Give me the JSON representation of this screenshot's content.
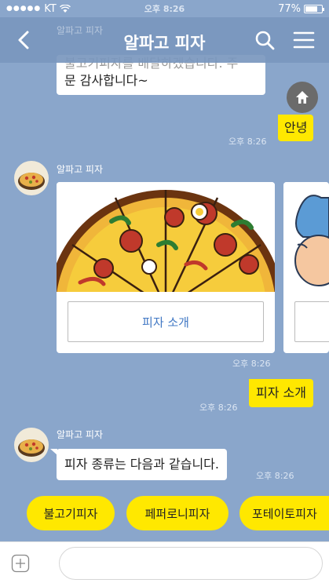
{
  "status": {
    "carrier": "KT",
    "time": "오후 8:26",
    "battery": "77%",
    "battery_level": 0.77
  },
  "header": {
    "title": "알파고 피자",
    "ghost_name": "알파고 피자"
  },
  "messages": {
    "top_bot_text": "불고기피자를 배달하겠습니다. 주문 감사합니다~",
    "top_bot_line1": "불고기피자를 배달하겠습니다. 주",
    "top_bot_line2": "문 감사합니다~",
    "user1_text": "안녕",
    "user1_time": "오후 8:26",
    "sender_name": "알파고 피자",
    "card1_button": "피자 소개",
    "card_time": "오후 8:26",
    "user2_text": "피자 소개",
    "user2_time": "오후 8:26",
    "sender_name2": "알파고 피자",
    "bot_text": "피자 종류는 다음과 같습니다.",
    "bot_time": "오후 8:26"
  },
  "quick_replies": [
    "불고기피자",
    "페퍼로니피자",
    "포테이토피자"
  ],
  "colors": {
    "background": "#8aa6cb",
    "yellow": "#ffe800",
    "link": "#4178c4"
  }
}
